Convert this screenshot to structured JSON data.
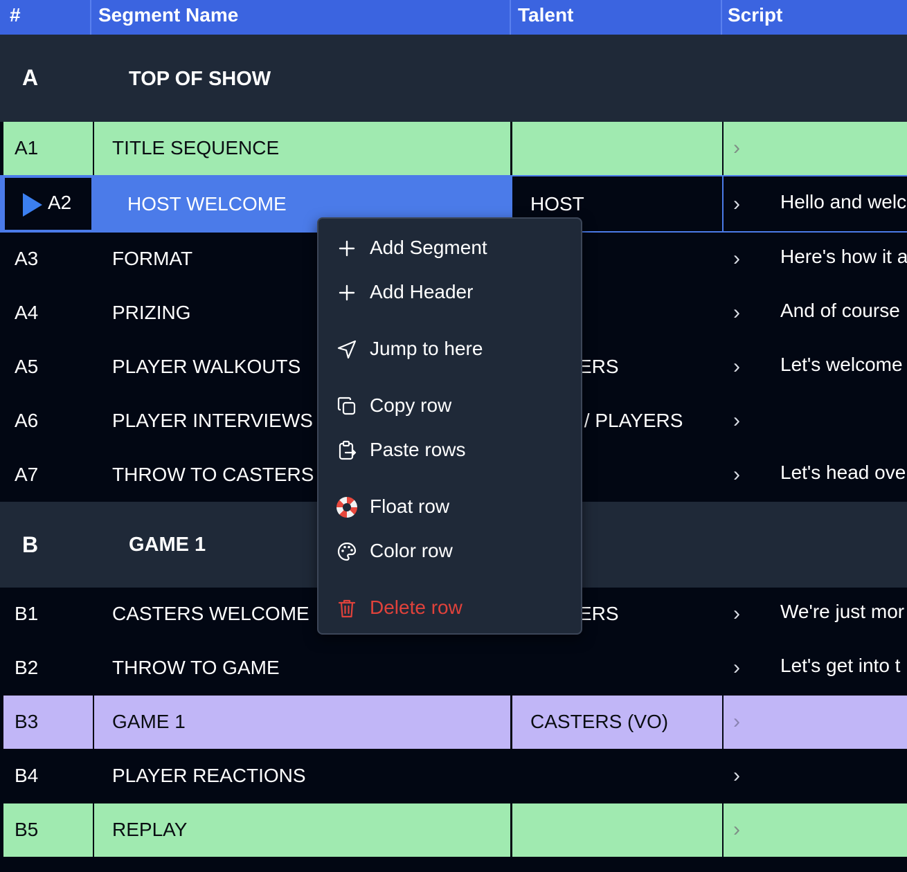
{
  "columns": {
    "number": "#",
    "segment_name": "Segment Name",
    "talent": "Talent",
    "script": "Script"
  },
  "groups": [
    {
      "id": "A",
      "name": "TOP OF SHOW"
    },
    {
      "id": "B",
      "name": "GAME 1"
    }
  ],
  "rows_a": [
    {
      "id": "A1",
      "name": "TITLE SEQUENCE",
      "talent": "",
      "script": "",
      "color": "green"
    },
    {
      "id": "A2",
      "name": "HOST WELCOME",
      "talent": "HOST",
      "script": "Hello and welc",
      "selected": true
    },
    {
      "id": "A3",
      "name": "FORMAT",
      "talent": "",
      "script": "Here's how it a"
    },
    {
      "id": "A4",
      "name": "PRIZING",
      "talent": "",
      "script": "And of course"
    },
    {
      "id": "A5",
      "name": "PLAYER WALKOUTS",
      "talent": "ERS",
      "script": "Let's welcome"
    },
    {
      "id": "A6",
      "name": "PLAYER INTERVIEWS",
      "talent": " / PLAYERS",
      "script": ""
    },
    {
      "id": "A7",
      "name": "THROW TO CASTERS",
      "talent": "",
      "script": "Let's head ove"
    }
  ],
  "rows_b": [
    {
      "id": "B1",
      "name": "CASTERS WELCOME",
      "talent": "ERS",
      "script": "We're just mor"
    },
    {
      "id": "B2",
      "name": "THROW TO GAME",
      "talent": "",
      "script": "Let's get into t"
    },
    {
      "id": "B3",
      "name": "GAME 1",
      "talent": "CASTERS (VO)",
      "script": "",
      "color": "purple"
    },
    {
      "id": "B4",
      "name": "PLAYER REACTIONS",
      "talent": "",
      "script": ""
    },
    {
      "id": "B5",
      "name": "REPLAY",
      "talent": "",
      "script": "",
      "color": "green"
    }
  ],
  "chevron": "›",
  "context_menu": {
    "add_segment": "Add Segment",
    "add_header": "Add Header",
    "jump_to_here": "Jump to here",
    "copy_row": "Copy row",
    "paste_rows": "Paste rows",
    "float_row": "Float row",
    "color_row": "Color row",
    "delete_row": "Delete row"
  },
  "colors": {
    "header": "#3b64e0",
    "selected": "#4b7be9",
    "green_row": "#a0eab0",
    "purple_row": "#c1b6f7",
    "danger": "#e0423b"
  }
}
